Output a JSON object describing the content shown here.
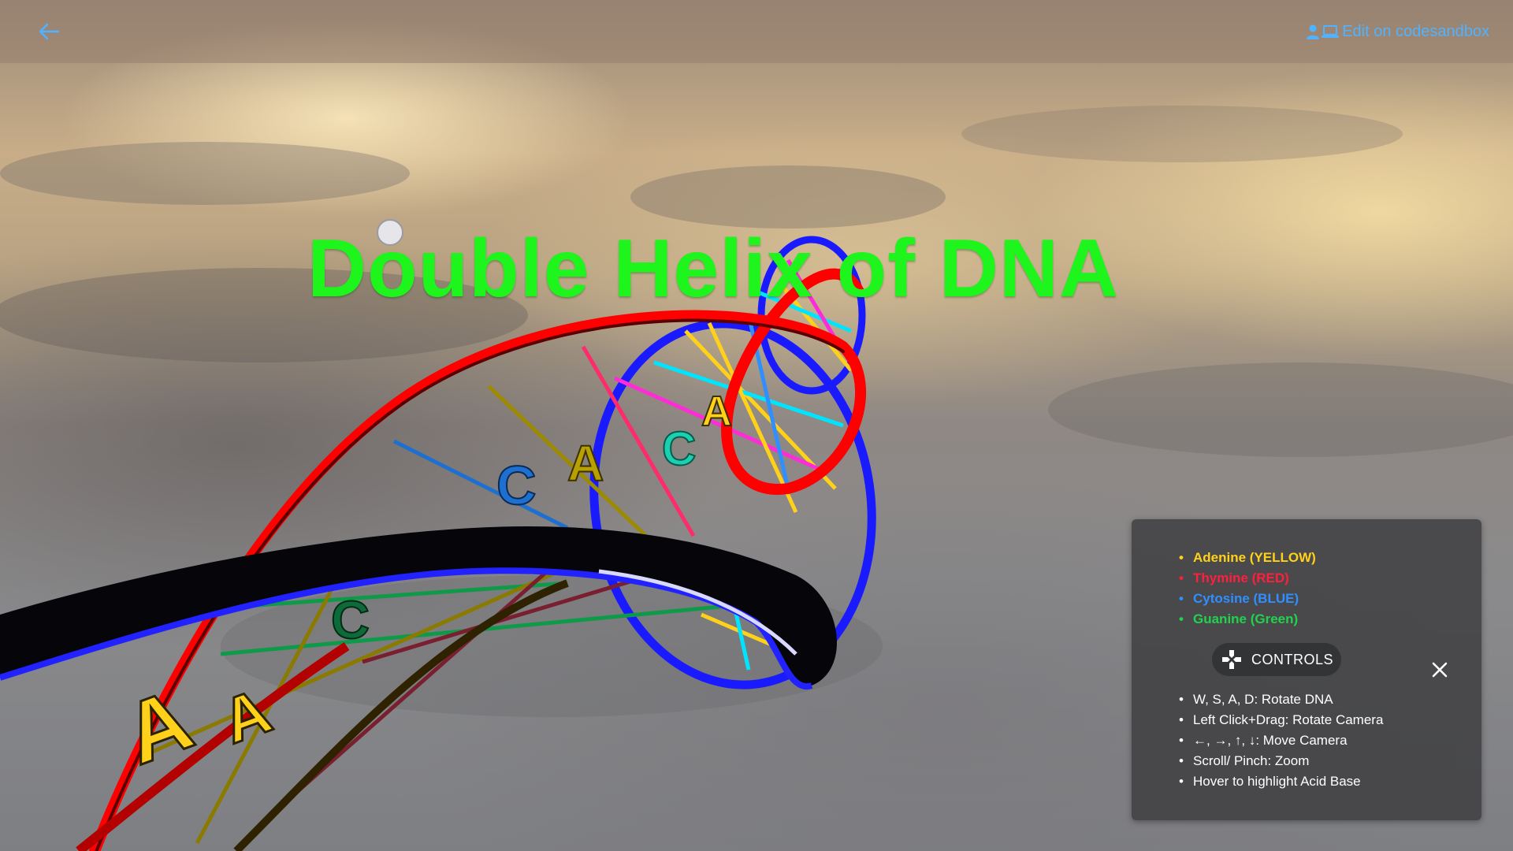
{
  "header": {
    "back_icon": "arrow-left-icon",
    "edit_label": "Edit on codesandbox",
    "edit_icons": [
      "person-icon",
      "laptop-icon"
    ],
    "link_color": "#4fb3ff"
  },
  "scene": {
    "title": "Double Helix of DNA",
    "title_color": "#1df51d",
    "strand_colors": {
      "primary": "#ff0000",
      "secondary": "#1a1aff"
    },
    "base_letters": [
      "A",
      "A",
      "C",
      "A",
      "C"
    ]
  },
  "panel": {
    "legend": [
      {
        "label": "Adenine (YELLOW)",
        "color": "#ffd11a"
      },
      {
        "label": "Thymine (RED)",
        "color": "#ff1f3d"
      },
      {
        "label": "Cytosine (BLUE)",
        "color": "#2f8fff"
      },
      {
        "label": "Guanine (Green)",
        "color": "#22d24d"
      }
    ],
    "controls_label": "CONTROLS",
    "controls_icon": "gamepad-icon",
    "close_icon": "close-icon",
    "controls": [
      "W, S, A, D: Rotate DNA",
      "Left Click+Drag: Rotate Camera",
      "←, →, ↑, ↓: Move Camera",
      "Scroll/ Pinch: Zoom",
      "Hover to highlight Acid Base"
    ]
  }
}
